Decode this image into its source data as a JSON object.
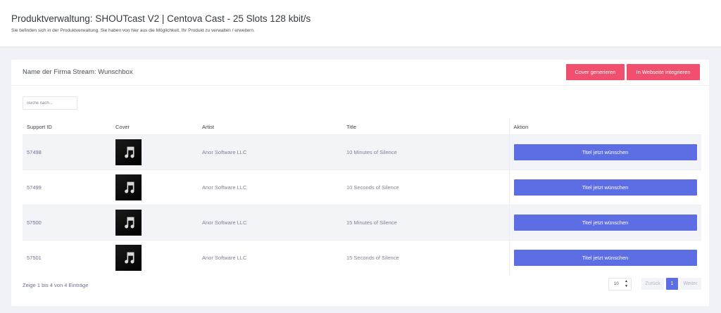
{
  "header": {
    "title": "Produktverwaltung: SHOUTcast V2 | Centova Cast - 25 Slots 128 kbit/s",
    "subtitle": "Sie befinden sich in der Produktverwaltung. Sie haben von hier aus die Möglichkeit, Ihr Produkt zu verwalten / erweitern."
  },
  "card": {
    "title": "Name der Firma Stream: Wunschbox",
    "cover_button": "Cover generieren",
    "embed_button": "In Webseite integrieren"
  },
  "search": {
    "placeholder": "Suche nach..."
  },
  "table": {
    "columns": [
      "Support ID",
      "Cover",
      "Artist",
      "Title",
      "Aktion"
    ],
    "rows": [
      {
        "id": "57498",
        "artist": "Anor Software LLC",
        "title": "10 Minutes of Silence",
        "action": "Titel jetzt wünschen",
        "cover_icon": "music-note-icon"
      },
      {
        "id": "57499",
        "artist": "Anor Software LLC",
        "title": "10 Seconds of Silence",
        "action": "Titel jetzt wünschen",
        "cover_icon": "music-note-icon"
      },
      {
        "id": "57500",
        "artist": "Anor Software LLC",
        "title": "15 Minutes of Silence",
        "action": "Titel jetzt wünschen",
        "cover_icon": "music-note-icon"
      },
      {
        "id": "57501",
        "artist": "Anor Software LLC",
        "title": "15 Seconds of Silence",
        "action": "Titel jetzt wünschen",
        "cover_icon": "music-note-icon"
      }
    ]
  },
  "footer": {
    "info": "Zeige 1 bis 4 von 4 Einträge",
    "page_size": "10",
    "prev": "Zurück",
    "current_page": "1",
    "next": "Weiter"
  },
  "colors": {
    "accent_red": "#f0506e",
    "accent_blue": "#5d6de3",
    "background": "#f1f2f7"
  }
}
